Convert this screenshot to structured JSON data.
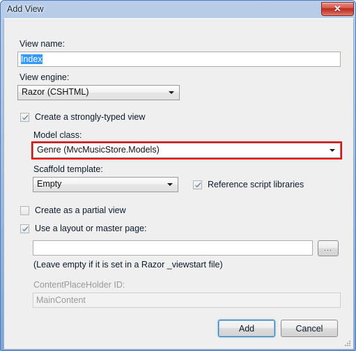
{
  "window": {
    "title": "Add View",
    "close_label": "✕",
    "close_icon": "close-icon"
  },
  "form": {
    "view_name_label": "View name:",
    "view_name_value": "Index",
    "view_engine_label": "View engine:",
    "view_engine_value": "Razor (CSHTML)",
    "strongly_typed_label": "Create a strongly-typed view",
    "strongly_typed_checked": true,
    "model_class_label": "Model class:",
    "model_class_value": "Genre (MvcMusicStore.Models)",
    "model_class_highlight_color": "#ff0000",
    "scaffold_template_label": "Scaffold template:",
    "scaffold_template_value": "Empty",
    "reference_scripts_label": "Reference script libraries",
    "reference_scripts_checked": true,
    "partial_view_label": "Create as a partial view",
    "partial_view_checked": false,
    "layout_page_label": "Use a layout or master page:",
    "layout_page_checked": true,
    "layout_path_value": "",
    "layout_path_placeholder": "",
    "browse_label": "...",
    "layout_hint": "(Leave empty if it is set in a Razor _viewstart file)",
    "contentplaceholder_label": "ContentPlaceHolder ID:",
    "contentplaceholder_value": "MainContent",
    "contentplaceholder_disabled": true
  },
  "footer": {
    "add_label": "Add",
    "cancel_label": "Cancel"
  }
}
